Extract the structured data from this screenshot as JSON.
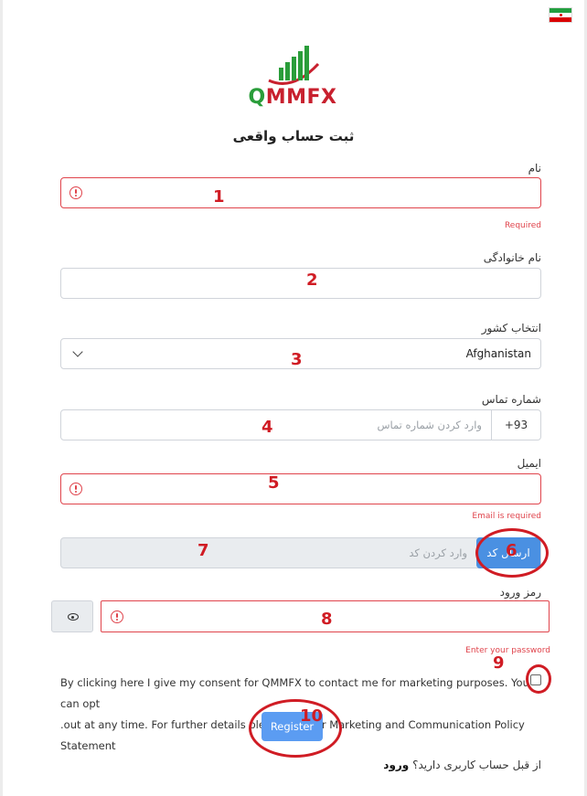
{
  "header": {
    "flag_icon": "iran-flag-icon",
    "brand": {
      "part1": "Q",
      "part2": "MMFX"
    },
    "title": "ثبت حساب واقعی"
  },
  "form": {
    "first_name": {
      "label": "نام",
      "error": "Required"
    },
    "last_name": {
      "label": "نام خانوادگی"
    },
    "country": {
      "label": "انتخاب کشور",
      "value": "Afghanistan"
    },
    "phone": {
      "label": "شماره تماس",
      "code": "+93",
      "placeholder": "وارد کردن شماره تماس"
    },
    "email": {
      "label": "ایمیل",
      "error": "Email is required"
    },
    "code": {
      "placeholder": "وارد کردن کد",
      "send_label": "ارسال کد"
    },
    "password": {
      "label": "رمز ورود",
      "error": "Enter your password"
    },
    "consent": {
      "line1": "By clicking here I give my consent for QMMFX to contact me for marketing purposes. You can opt",
      "line2": ".out at any time. For further details please see our Marketing and Communication Policy Statement"
    },
    "register_label": "Register",
    "login_prompt": "از قبل حساب کاربری دارید؟",
    "login_link": "ورود"
  },
  "annotations": [
    "1",
    "2",
    "3",
    "4",
    "5",
    "6",
    "7",
    "8",
    "9",
    "10"
  ],
  "colors": {
    "error": "#e0444c",
    "primary": "#4a90e2",
    "annotation": "#d01c24"
  }
}
